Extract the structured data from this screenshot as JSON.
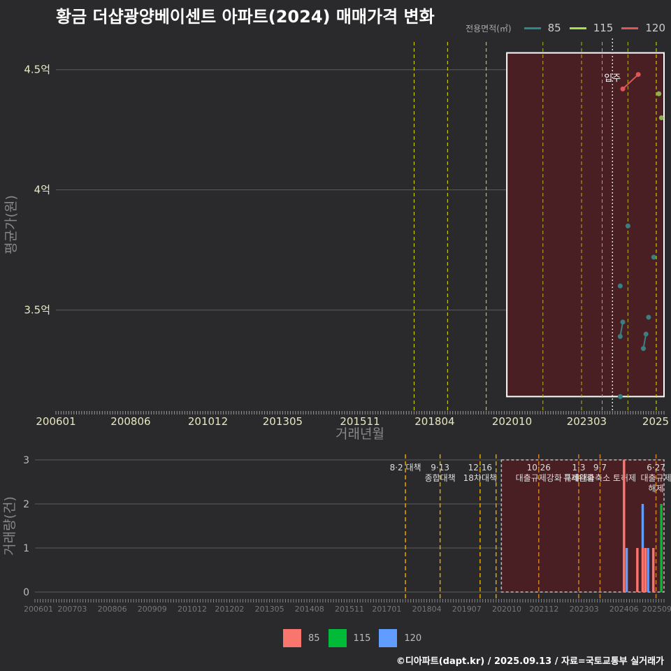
{
  "title": "황금 더샵광양베이센트 아파트(2024) 매매가격 변화",
  "footer": "©디아파트(dapt.kr) / 2025.09.13 / 자료=국토교통부 실거래가",
  "legend_top": {
    "title": "전용면적(㎡)",
    "items": [
      {
        "label": "85",
        "color": "#2a8a8a"
      },
      {
        "label": "115",
        "color": "#a6e04a"
      },
      {
        "label": "120",
        "color": "#e05555"
      }
    ]
  },
  "legend_bottom": {
    "items": [
      {
        "label": "85",
        "color": "#f8766d"
      },
      {
        "label": "115",
        "color": "#00ba38"
      },
      {
        "label": "120",
        "color": "#619cff"
      }
    ]
  },
  "chart_data": [
    {
      "type": "line",
      "title": "황금 더샵광양베이센트 아파트(2024) 매매가격 변화",
      "xlabel": "거래년월",
      "ylabel": "평균가(원)",
      "x_tick_labels": [
        "200601",
        "200806",
        "201012",
        "201305",
        "201511",
        "201804",
        "202010",
        "202303",
        "2025"
      ],
      "x_tick_values": [
        "2006-01",
        "2008-06",
        "2010-12",
        "2013-05",
        "2015-11",
        "2018-04",
        "2020-10",
        "2023-03",
        "2025-09"
      ],
      "xlim": [
        "2006-01",
        "2025-09"
      ],
      "ylim": [
        3.08,
        4.63
      ],
      "y_ticks": [
        3.5,
        4.0,
        4.5
      ],
      "y_tick_labels": [
        "3.5억",
        "4억",
        "4.5억"
      ],
      "vlines": [
        {
          "date": "2017-08",
          "color": "#e5e500"
        },
        {
          "date": "2018-09",
          "color": "#e5e500"
        },
        {
          "date": "2019-12",
          "color": "#e5e500"
        },
        {
          "date": "2021-10",
          "color": "#b5b520"
        },
        {
          "date": "2023-01",
          "color": "#b5b520"
        },
        {
          "date": "2023-09",
          "color": "#b5b520"
        },
        {
          "date": "2024-07",
          "color": "#b5b520"
        },
        {
          "date": "2025-06",
          "color": "#e5e500"
        }
      ],
      "move_in": {
        "date": "2024-01",
        "label": "입주"
      },
      "highlight": {
        "from": "2020-08",
        "to": "2025-09",
        "y_from": 3.14,
        "y_to": 4.57
      },
      "series": [
        {
          "name": "85",
          "color": "#3a8080",
          "points": [
            {
              "x": "2024-04",
              "y": 3.14
            },
            {
              "x": "2024-04",
              "y": 3.6
            },
            {
              "x": "2024-04",
              "y": 3.39
            },
            {
              "x": "2024-05",
              "y": 3.45
            },
            {
              "x": "2024-07",
              "y": 3.85
            },
            {
              "x": "2025-01",
              "y": 3.34
            },
            {
              "x": "2025-02",
              "y": 3.4
            },
            {
              "x": "2025-03",
              "y": 3.47
            },
            {
              "x": "2025-05",
              "y": 3.72
            }
          ],
          "line_segments": [
            [
              2,
              3
            ],
            [
              5,
              6
            ]
          ]
        },
        {
          "name": "115",
          "color": "#8fae55",
          "points": [
            {
              "x": "2025-07",
              "y": 4.4
            },
            {
              "x": "2025-08",
              "y": 4.3
            }
          ],
          "line_segments": []
        },
        {
          "name": "120",
          "color": "#e05555",
          "points": [
            {
              "x": "2024-05",
              "y": 4.42
            },
            {
              "x": "2024-11",
              "y": 4.48
            }
          ],
          "line_segments": [
            [
              0,
              1
            ]
          ]
        }
      ]
    },
    {
      "type": "bar",
      "xlabel": "",
      "ylabel": "거래량(건)",
      "x_tick_labels": [
        "200601",
        "200703",
        "200806",
        "200909",
        "201012",
        "201202",
        "201305",
        "201408",
        "201511",
        "201701",
        "201804",
        "201907",
        "202010",
        "202112",
        "202303",
        "202406",
        "202509"
      ],
      "x_tick_values": [
        "2006-01",
        "2007-03",
        "2008-06",
        "2009-09",
        "2010-12",
        "2012-02",
        "2013-05",
        "2014-08",
        "2015-11",
        "2017-01",
        "2018-04",
        "2019-07",
        "2020-10",
        "2021-12",
        "2023-03",
        "2024-06",
        "2025-09"
      ],
      "ylim": [
        0,
        3
      ],
      "y_ticks": [
        0,
        1,
        2,
        3
      ],
      "highlight": {
        "from": "2020-08",
        "to": "2025-09",
        "y_from": 0,
        "y_to": 3
      },
      "events": [
        {
          "date": "2017-08",
          "lines": [
            "8·2 대책"
          ],
          "color": "#e5a500"
        },
        {
          "date": "2018-09",
          "lines": [
            "9·13",
            "종합대책"
          ],
          "color": "#e5a500"
        },
        {
          "date": "2019-12",
          "lines": [
            "12·16",
            "18차대책"
          ],
          "color": "#e5a500"
        },
        {
          "date": "2020-06",
          "lines": [],
          "color": "#e5a500"
        },
        {
          "date": "2021-10",
          "lines": [
            "10·26",
            "대출규제강화"
          ],
          "color": "#d08020"
        },
        {
          "date": "2023-01",
          "lines": [
            "1·3",
            "규제완화"
          ],
          "color": "#d08020"
        },
        {
          "date": "2023-09",
          "lines": [
            "9·7",
            "특례대출축소 토허제"
          ],
          "color": "#d08020"
        },
        {
          "date": "2025-06",
          "lines": [
            "6·27",
            "대출규제",
            "해제"
          ],
          "color": "#d08020"
        }
      ],
      "bars": [
        {
          "x": "2024-06",
          "stack": [
            {
              "series": "85",
              "value": 3
            }
          ]
        },
        {
          "x": "2024-07",
          "stack": [
            {
              "series": "120",
              "value": 1
            }
          ]
        },
        {
          "x": "2024-11",
          "stack": [
            {
              "series": "85",
              "value": 1
            }
          ]
        },
        {
          "x": "2025-01",
          "stack": [
            {
              "series": "85",
              "value": 1
            },
            {
              "series": "120",
              "value": 1
            }
          ]
        },
        {
          "x": "2025-02",
          "stack": [
            {
              "series": "85",
              "value": 1
            }
          ]
        },
        {
          "x": "2025-03",
          "stack": [
            {
              "series": "120",
              "value": 1
            }
          ]
        },
        {
          "x": "2025-05",
          "stack": [
            {
              "series": "85",
              "value": 1
            }
          ]
        },
        {
          "x": "2025-08",
          "stack": [
            {
              "series": "115",
              "value": 2
            }
          ]
        }
      ]
    }
  ]
}
